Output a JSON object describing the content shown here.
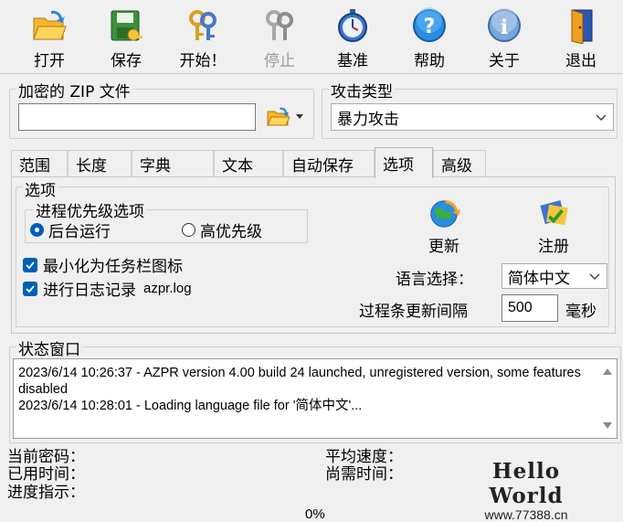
{
  "toolbar": {
    "open": "打开",
    "save": "保存",
    "start": "开始！",
    "stop": "停止",
    "benchmark": "基准",
    "help": "帮助",
    "about": "关于",
    "exit": "退出"
  },
  "zip_group": {
    "title": "加密的 ZIP 文件",
    "path_value": ""
  },
  "attack_group": {
    "title": "攻击类型",
    "selected": "暴力攻击"
  },
  "tabs": [
    "范围",
    "长度",
    "字典",
    "文本",
    "自动保存",
    "选项",
    "高级"
  ],
  "active_tab": "选项",
  "options": {
    "title": "选项",
    "priority": {
      "title": "进程优先级选项",
      "background": "后台运行",
      "high": "高优先级"
    },
    "minimize_tray": "最小化为任务栏图标",
    "log_prefix": "进行日志记录",
    "log_file": "azpr.log",
    "update": "更新",
    "register": "注册",
    "language_label": "语言选择：",
    "language_value": "简体中文",
    "progress_interval_label": "过程条更新间隔",
    "progress_interval_value": "500",
    "progress_interval_unit": "毫秒"
  },
  "status": {
    "title": "状态窗口",
    "lines": [
      "2023/6/14 10:26:37 - AZPR version 4.00 build 24 launched, unregistered version, some features disabled",
      "2023/6/14 10:28:01 - Loading language file for '简体中文'..."
    ]
  },
  "stats": {
    "current_password": "当前密码：",
    "time_used": "已用时间：",
    "progress": "进度指示：",
    "avg_speed": "平均速度：",
    "time_remaining": "尚需时间："
  },
  "progress_value": "0%",
  "watermark": {
    "title": "Hello World",
    "url": "www.77388.cn"
  },
  "colors": {
    "accent": "#005fb8",
    "window_bg": "#f0f0f0"
  }
}
